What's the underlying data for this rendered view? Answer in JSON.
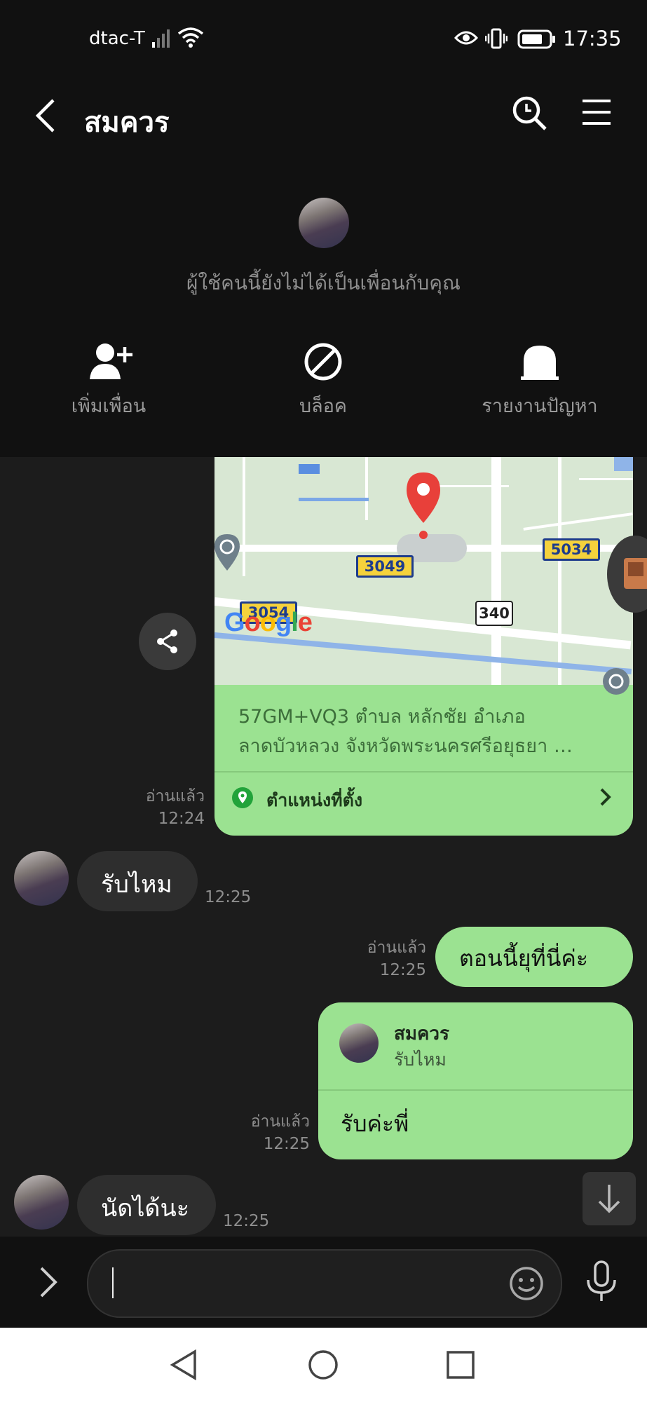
{
  "status_bar": {
    "carrier": "dtac-T",
    "time": "17:35"
  },
  "header": {
    "title": "สมควร"
  },
  "profile": {
    "notice": "ผู้ใช้คนนี้ยังไม่ได้เป็นเพื่อนกับคุณ",
    "actions": [
      {
        "label": "เพิ่มเพื่อน",
        "icon": "add-friend-icon"
      },
      {
        "label": "บล็อค",
        "icon": "block-icon"
      },
      {
        "label": "รายงานปัญหา",
        "icon": "report-icon"
      }
    ]
  },
  "messages": {
    "location": {
      "address_line1": "57GM+VQ3 ตำบล หลักชัย อำเภอ",
      "address_line2": "ลาดบัวหลวง จังหวัดพระนครศรีอยุธยา …",
      "footer_label": "ตำแหน่งที่ตั้ง",
      "read": "อ่านแล้ว",
      "time": "12:24",
      "map": {
        "road_labels": [
          "3049",
          "3054",
          "5034",
          "340"
        ],
        "logo": "Google"
      }
    },
    "msg1": {
      "text": "รับไหม",
      "time": "12:25"
    },
    "msg2": {
      "text": "ตอนนี้ยุที่นี่ค่ะ",
      "read": "อ่านแล้ว",
      "time": "12:25"
    },
    "msg3": {
      "quote_name": "สมควร",
      "quote_text": "รับไหม",
      "text": "รับค่ะพี่",
      "read": "อ่านแล้ว",
      "time": "12:25"
    },
    "msg4": {
      "text": "นัดได้นะ",
      "time": "12:25"
    }
  },
  "composer": {
    "input_value": ""
  },
  "colors": {
    "outgoing_bubble": "#9be291",
    "incoming_bubble": "#2e2e2e",
    "background": "#1c1c1c",
    "pin": "#e8403a"
  }
}
